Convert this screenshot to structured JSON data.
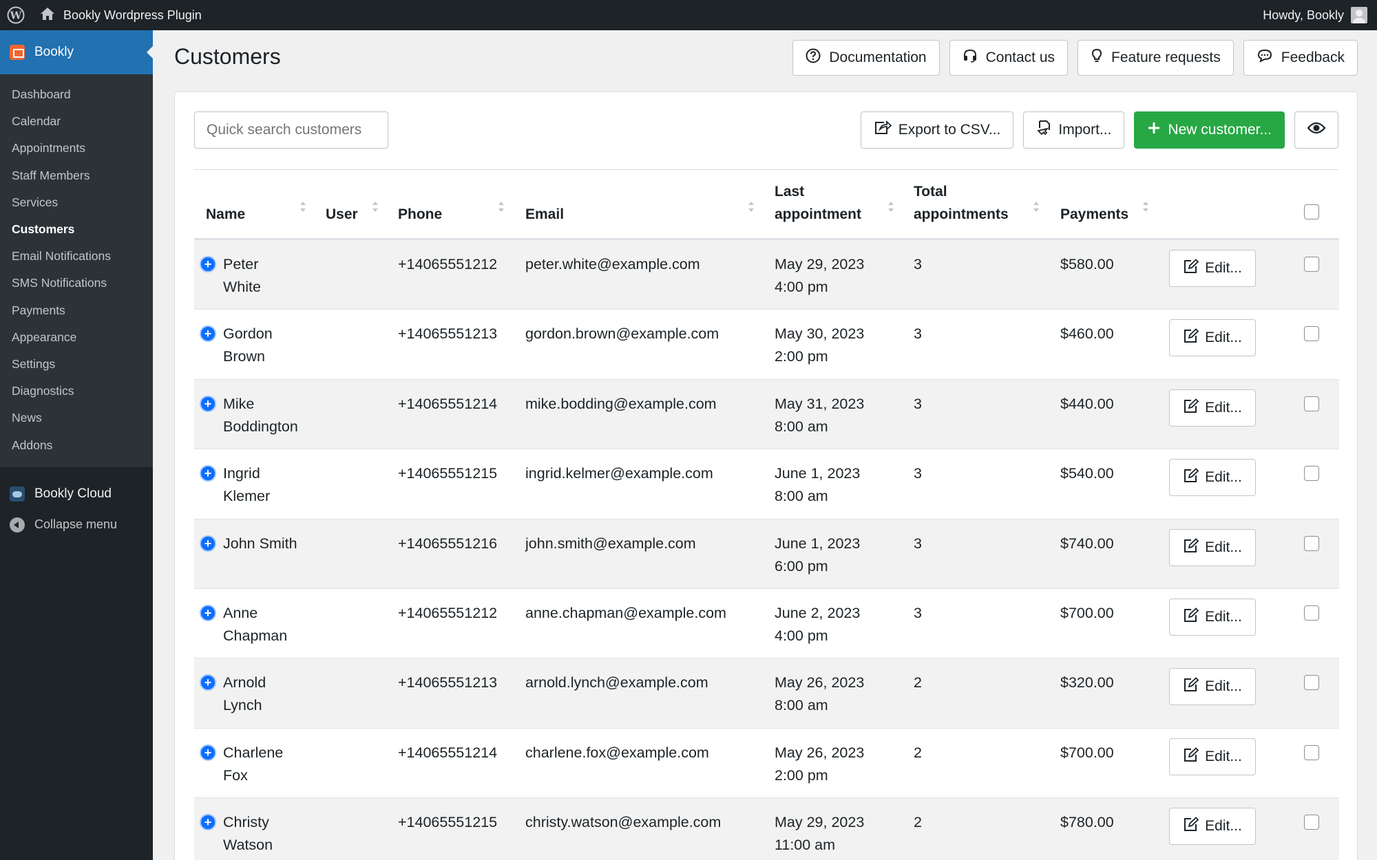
{
  "adminbar": {
    "site_title": "Bookly Wordpress Plugin",
    "howdy": "Howdy, Bookly"
  },
  "sidebar": {
    "top_item": "Bookly",
    "items": [
      {
        "label": "Dashboard"
      },
      {
        "label": "Calendar"
      },
      {
        "label": "Appointments"
      },
      {
        "label": "Staff Members"
      },
      {
        "label": "Services"
      },
      {
        "label": "Customers",
        "current": true
      },
      {
        "label": "Email Notifications"
      },
      {
        "label": "SMS Notifications"
      },
      {
        "label": "Payments"
      },
      {
        "label": "Appearance"
      },
      {
        "label": "Settings"
      },
      {
        "label": "Diagnostics"
      },
      {
        "label": "News"
      },
      {
        "label": "Addons"
      }
    ],
    "cloud": "Bookly Cloud",
    "collapse": "Collapse menu"
  },
  "header": {
    "title": "Customers",
    "buttons": {
      "documentation": "Documentation",
      "contact": "Contact us",
      "feature": "Feature requests",
      "feedback": "Feedback"
    }
  },
  "toolbar": {
    "search_placeholder": "Quick search customers",
    "export": "Export to CSV...",
    "import": "Import...",
    "new_customer": "New customer..."
  },
  "table": {
    "headers": {
      "name": "Name",
      "user": "User",
      "phone": "Phone",
      "email": "Email",
      "last_line1": "Last",
      "last_line2": "appointment",
      "total_line1": "Total",
      "total_line2": "appointments",
      "payments": "Payments"
    },
    "edit_label": "Edit...",
    "rows": [
      {
        "first": "Peter",
        "last": "White",
        "phone": "+14065551212",
        "email": "peter.white@example.com",
        "date": "May 29, 2023",
        "time": "4:00 pm",
        "total": "3",
        "payments": "$580.00"
      },
      {
        "first": "Gordon",
        "last": "Brown",
        "phone": "+14065551213",
        "email": "gordon.brown@example.com",
        "date": "May 30, 2023",
        "time": "2:00 pm",
        "total": "3",
        "payments": "$460.00"
      },
      {
        "first": "Mike",
        "last": "Boddington",
        "phone": "+14065551214",
        "email": "mike.bodding@example.com",
        "date": "May 31, 2023",
        "time": "8:00 am",
        "total": "3",
        "payments": "$440.00"
      },
      {
        "first": "Ingrid",
        "last": "Klemer",
        "phone": "+14065551215",
        "email": "ingrid.kelmer@example.com",
        "date": "June 1, 2023",
        "time": "8:00 am",
        "total": "3",
        "payments": "$540.00"
      },
      {
        "first": "John Smith",
        "last": "",
        "phone": "+14065551216",
        "email": "john.smith@example.com",
        "date": "June 1, 2023",
        "time": "6:00 pm",
        "total": "3",
        "payments": "$740.00"
      },
      {
        "first": "Anne",
        "last": "Chapman",
        "phone": "+14065551212",
        "email": "anne.chapman@example.com",
        "date": "June 2, 2023",
        "time": "4:00 pm",
        "total": "3",
        "payments": "$700.00"
      },
      {
        "first": "Arnold",
        "last": "Lynch",
        "phone": "+14065551213",
        "email": "arnold.lynch@example.com",
        "date": "May 26, 2023",
        "time": "8:00 am",
        "total": "2",
        "payments": "$320.00"
      },
      {
        "first": "Charlene",
        "last": "Fox",
        "phone": "+14065551214",
        "email": "charlene.fox@example.com",
        "date": "May 26, 2023",
        "time": "2:00 pm",
        "total": "2",
        "payments": "$700.00"
      },
      {
        "first": "Christy",
        "last": "Watson",
        "phone": "+14065551215",
        "email": "christy.watson@example.com",
        "date": "May 29, 2023",
        "time": "11:00 am",
        "total": "2",
        "payments": "$780.00"
      }
    ]
  },
  "colors": {
    "adminbar": "#1d2327",
    "menu_active": "#2271b1",
    "green_button": "#28a745",
    "expand_icon": "#0d6efd"
  }
}
